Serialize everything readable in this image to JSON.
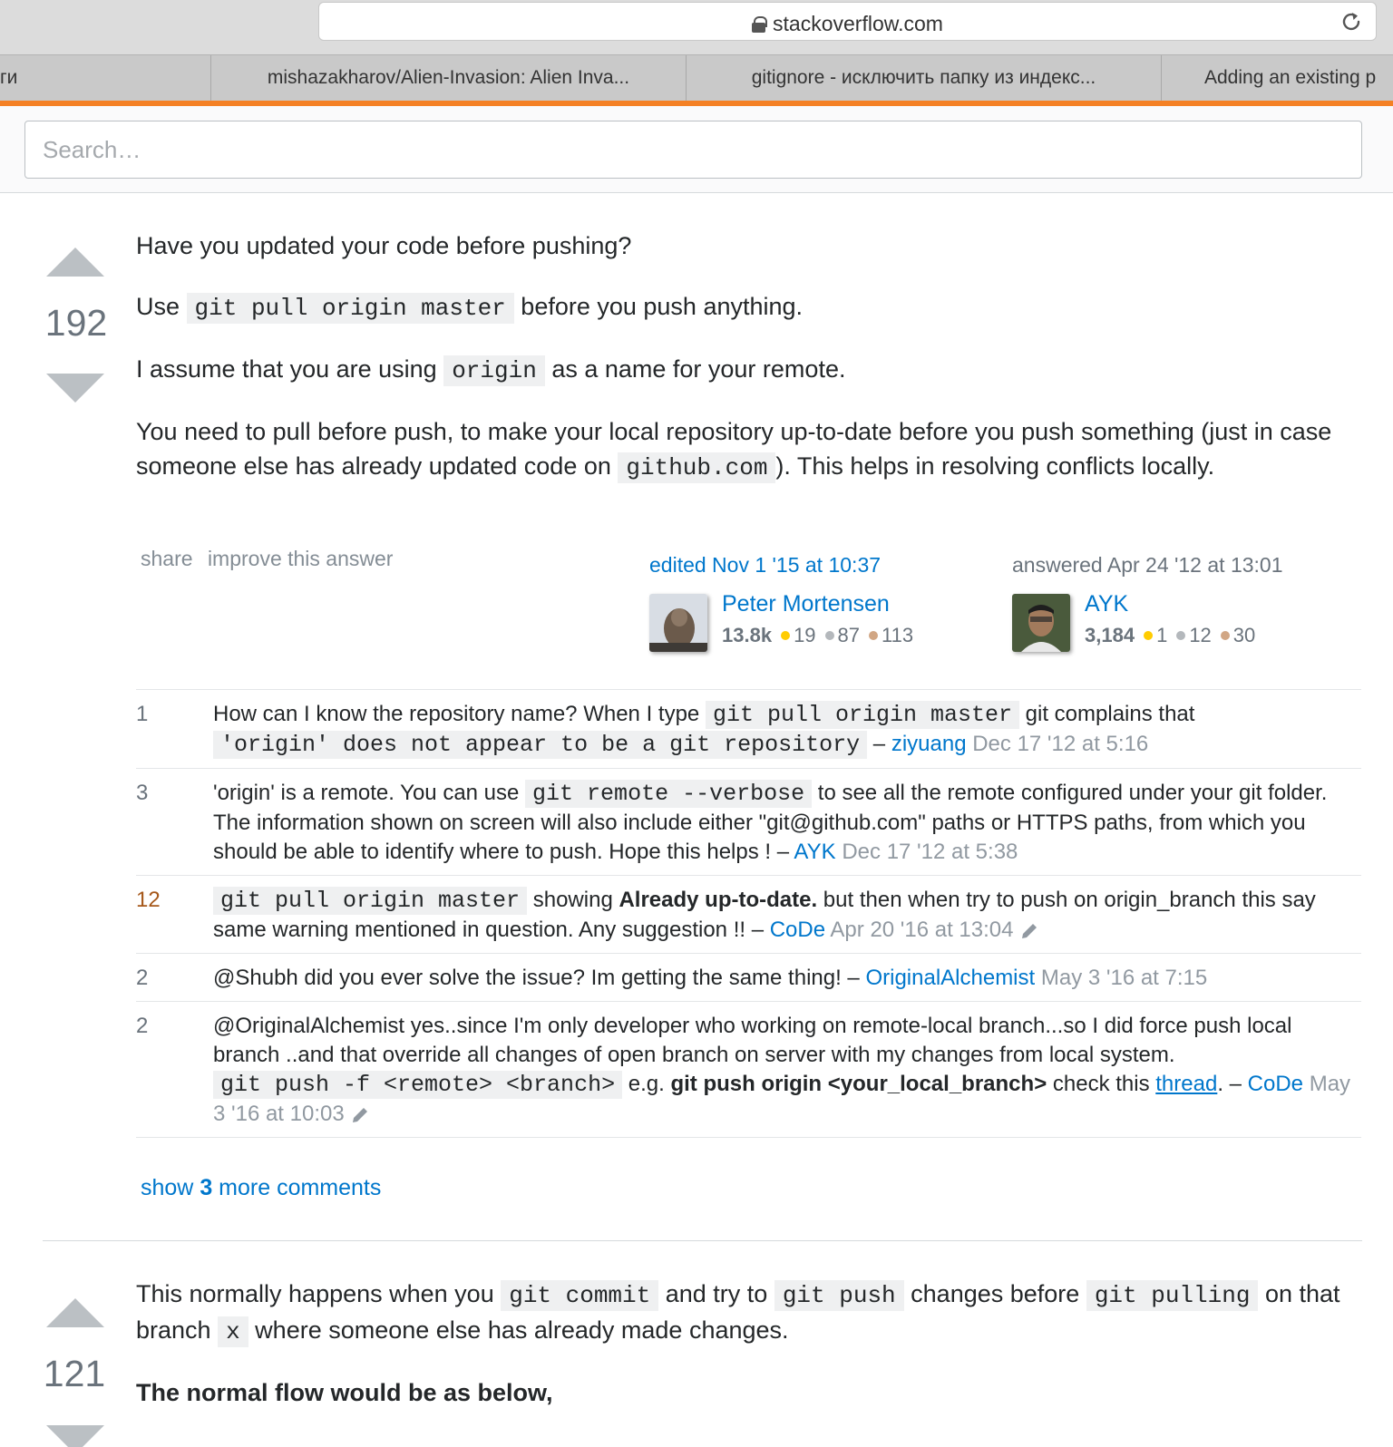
{
  "browser": {
    "url": "stackoverflow.com",
    "tabs": [
      "ги",
      "mishazakharov/Alien-Invasion: Alien Inva...",
      "gitignore - исключить папку из индекс...",
      "Adding an existing p"
    ],
    "accent_color": "#f48024"
  },
  "search": {
    "placeholder": "Search…"
  },
  "answer1": {
    "votes": "192",
    "paragraphs": {
      "p1": "Have you updated your code before pushing?",
      "p2_pre": "Use ",
      "p2_code": "git pull origin master",
      "p2_post": " before you push anything.",
      "p3_pre": "I assume that you are using ",
      "p3_code": "origin",
      "p3_post": " as a name for your remote.",
      "p4_pre": "You need to pull before push, to make your local repository up-to-date before you push something (just in case someone else has already updated code on ",
      "p4_code": "github.com",
      "p4_post": "). This helps in resolving conflicts locally."
    },
    "menu": {
      "share": "share",
      "improve": "improve this answer"
    },
    "editor": {
      "action": "edited Nov 1 '15 at 10:37",
      "name": "Peter Mortensen",
      "rep": "13.8k",
      "gold": "19",
      "silver": "87",
      "bronze": "113"
    },
    "owner": {
      "action": "answered Apr 24 '12 at 13:01",
      "name": "AYK",
      "rep": "3,184",
      "gold": "1",
      "silver": "12",
      "bronze": "30"
    },
    "comments": [
      {
        "score": "1",
        "t1": "How can I know the repository name? When I type ",
        "c1": "git pull origin master",
        "t2": " git complains that ",
        "c2": "'origin' does not appear to be a git repository",
        "sep": " – ",
        "user": "ziyuang",
        "date": "Dec 17 '12 at 5:16"
      },
      {
        "score": "3",
        "t1": "'origin' is a remote. You can use ",
        "c1": "git remote --verbose",
        "t2": " to see all the remote configured under your git folder. The information shown on screen will also include either \"git@github.com\" paths or HTTPS paths, from which you should be able to identify where to push. Hope this helps !",
        "sep": " – ",
        "user": "AYK",
        "date": "Dec 17 '12 at 5:38"
      },
      {
        "score": "12",
        "c1": "git pull origin master",
        "t1": " showing ",
        "b1": "Already up-to-date.",
        "t2": " but then when try to push on origin_branch this say same warning mentioned in question. Any suggestion !!",
        "sep": " – ",
        "user": "CoDe",
        "date": "Apr 20 '16 at 13:04"
      },
      {
        "score": "2",
        "t1": "@Shubh did you ever solve the issue? Im getting the same thing!",
        "sep": " – ",
        "user": "OriginalAlchemist",
        "date": "May 3 '16 at 7:15"
      },
      {
        "score": "2",
        "t1": "@OriginalAlchemist yes..since I'm only developer who working on remote-local branch...so I did force push local branch ..and that override all changes of open branch on server with my changes from local system. ",
        "c1": "git push -f <remote> <branch>",
        "t2": " e.g. ",
        "b1": "git push origin <your_local_branch>",
        "t3": " check this ",
        "link": "thread",
        "t4": ".",
        "sep": " – ",
        "user": "CoDe",
        "date": "May 3 '16 at 10:03"
      }
    ],
    "show_more": {
      "pre": "show ",
      "count": "3",
      "post": " more comments"
    }
  },
  "answer2": {
    "votes": "121",
    "p1_a": "This normally happens when you ",
    "p1_c1": "git commit",
    "p1_b": " and try to ",
    "p1_c2": "git push",
    "p1_d": " changes before ",
    "p1_c3": "git pulling",
    "p1_e": " on that branch ",
    "p1_c4": "x",
    "p1_f": " where someone else has already made changes.",
    "p2": "The normal flow would be as below,"
  }
}
